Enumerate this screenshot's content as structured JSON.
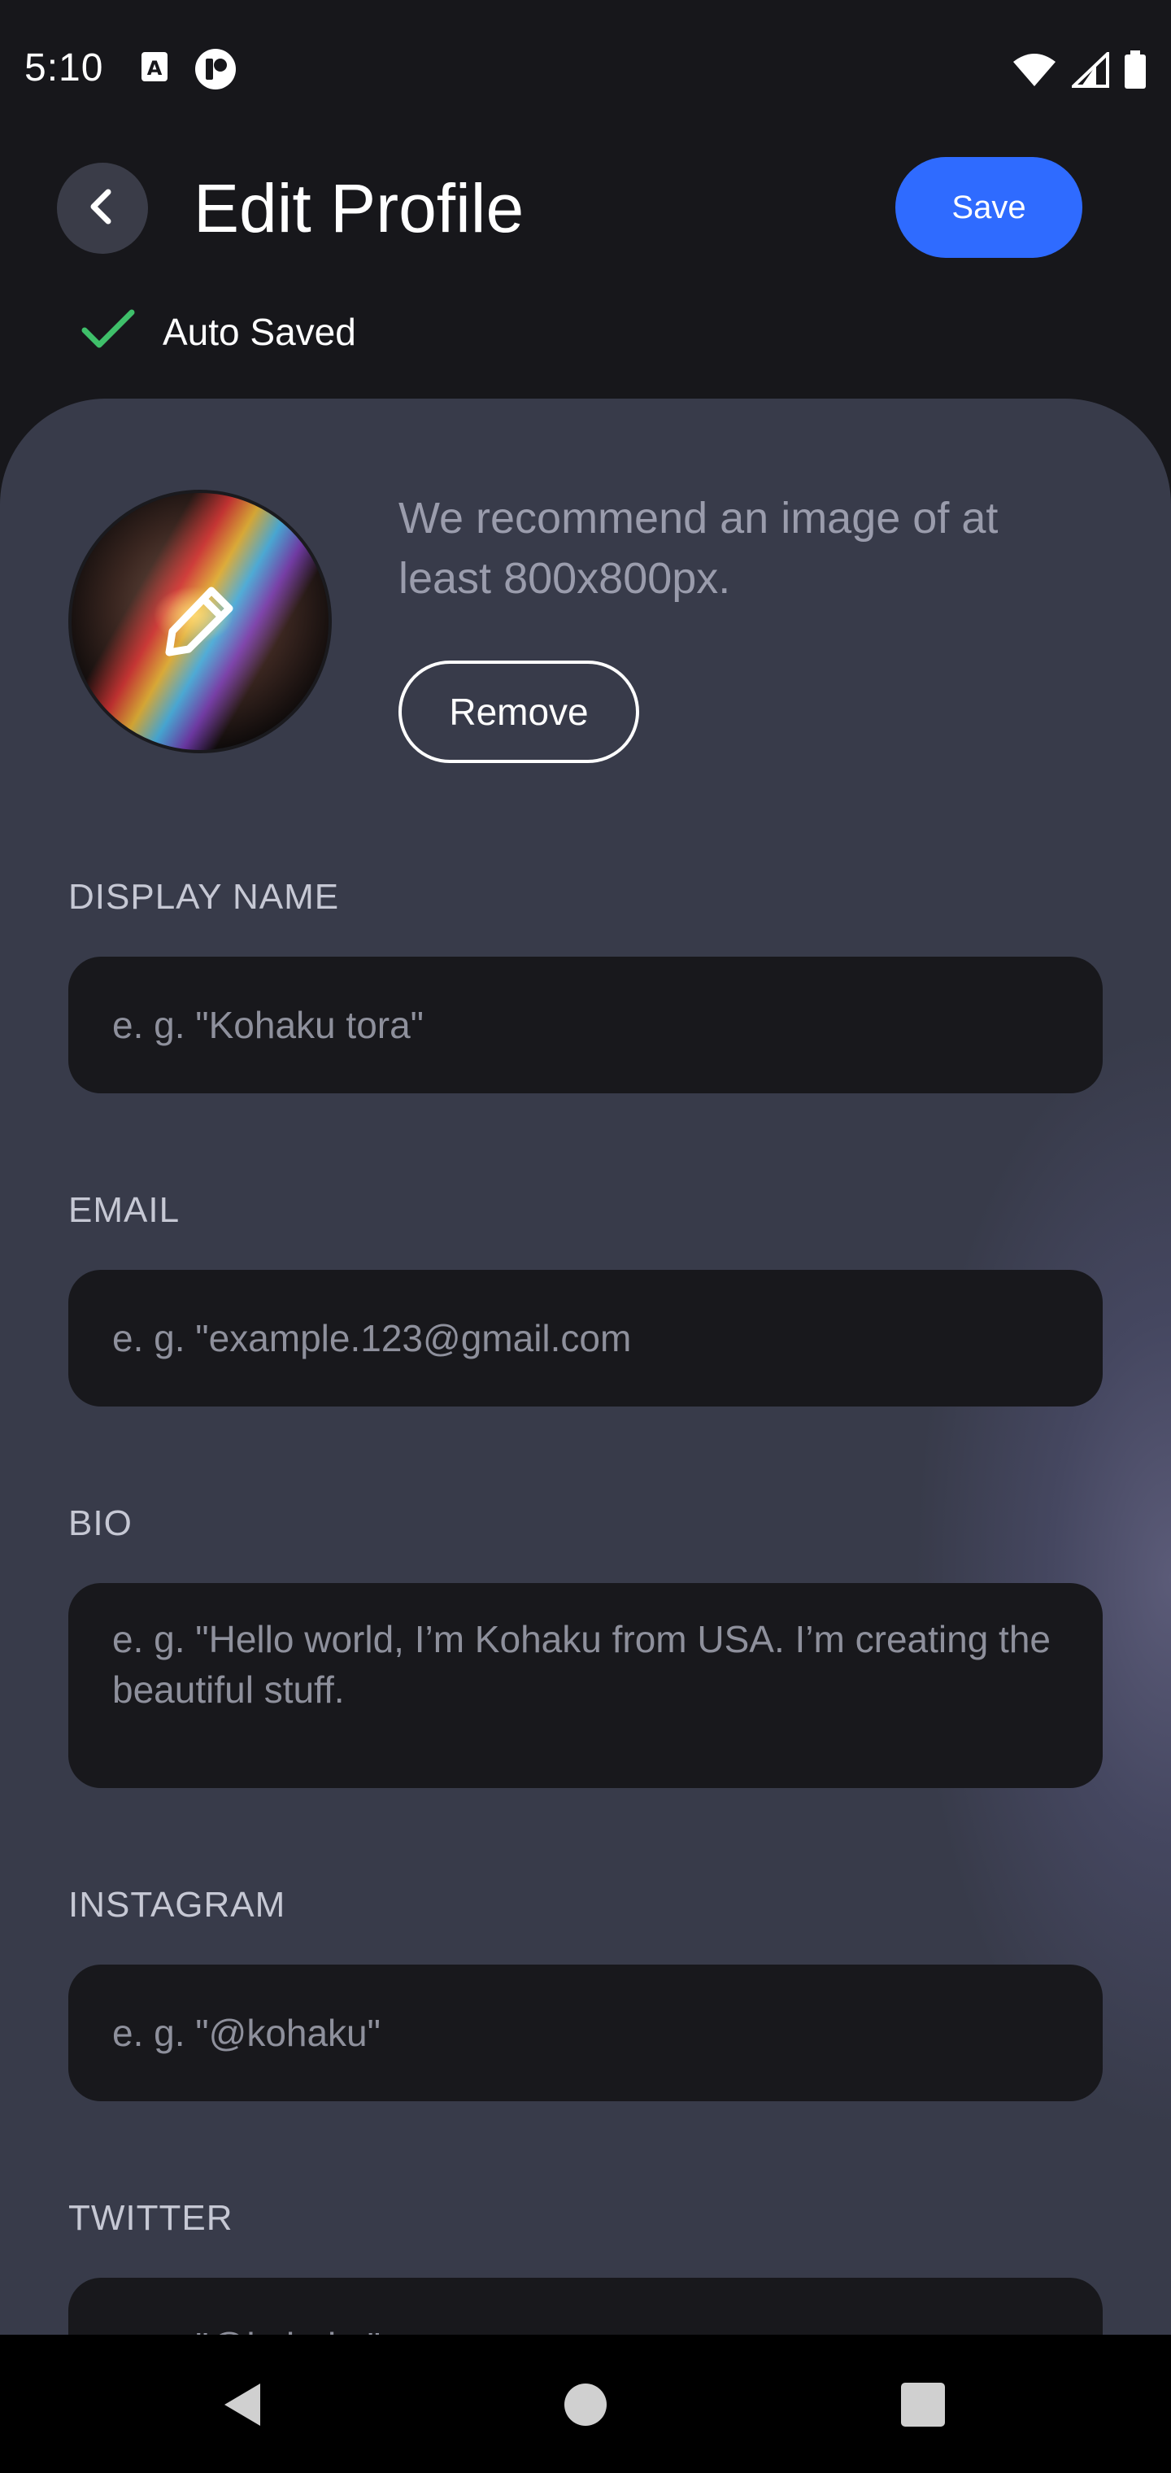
{
  "status_bar": {
    "time": "5:10",
    "left_icons": [
      "font-a-icon",
      "app-notification-icon"
    ],
    "right_icons": [
      "wifi-icon",
      "cell-signal-icon",
      "battery-icon"
    ]
  },
  "header": {
    "title": "Edit Profile",
    "save_label": "Save",
    "autosave_label": "Auto Saved",
    "colors": {
      "accent": "#2f6bff",
      "check": "#3fbf6a"
    }
  },
  "avatar": {
    "recommendation": "We recommend an image of at least 800x800px.",
    "remove_label": "Remove"
  },
  "fields": {
    "display_name": {
      "label": "DISPLAY NAME",
      "placeholder": "e. g. \"Kohaku tora\""
    },
    "email": {
      "label": "EMAIL",
      "placeholder": "e. g. \"example.123@gmail.com"
    },
    "bio": {
      "label": "BIO",
      "placeholder": "e. g. \"Hello world, I’m Kohaku from USA. I’m creating the beautiful stuff."
    },
    "instagram": {
      "label": "INSTAGRAM",
      "placeholder": "e. g. \"@kohaku\""
    },
    "twitter": {
      "label": "TWITTER",
      "placeholder": "e. g. \"@kohaku\""
    }
  },
  "nav_bar": {
    "icons": [
      "back-triangle-icon",
      "home-circle-icon",
      "recents-square-icon"
    ]
  }
}
